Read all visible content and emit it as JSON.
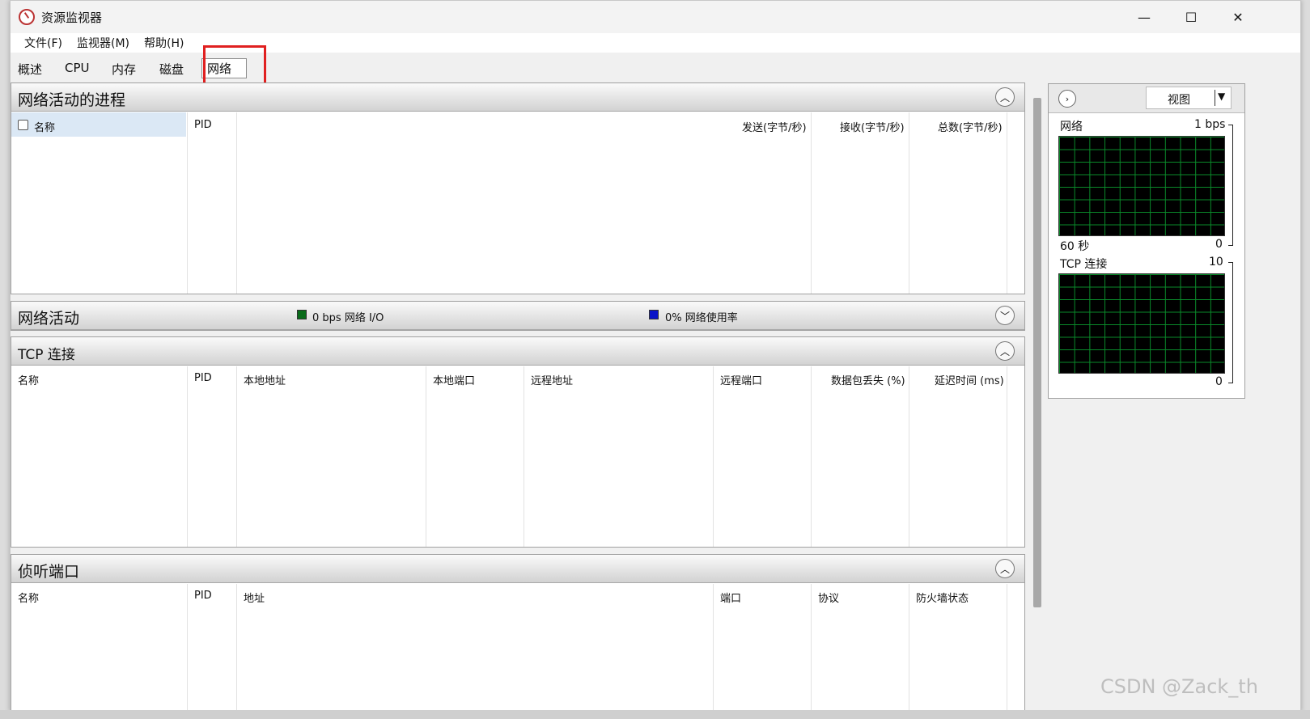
{
  "window": {
    "title": "资源监视器"
  },
  "window_controls": {
    "minimize": "—",
    "maximize": "☐",
    "close": "✕"
  },
  "menu": [
    "文件(F)",
    "监视器(M)",
    "帮助(H)"
  ],
  "tabs": [
    {
      "label": "概述",
      "active": false
    },
    {
      "label": "CPU",
      "active": false
    },
    {
      "label": "内存",
      "active": false
    },
    {
      "label": "磁盘",
      "active": false
    },
    {
      "label": "网络",
      "active": true
    }
  ],
  "processes_pane": {
    "title": "网络活动的进程",
    "columns": [
      "名称",
      "PID",
      "发送(字节/秒)",
      "接收(字节/秒)",
      "总数(字节/秒)"
    ]
  },
  "activity_pane": {
    "title": "网络活动",
    "legend_io": "0 bps 网络 I/O",
    "legend_util": "0% 网络使用率",
    "io_color": "#0a6b1a",
    "util_color": "#0a14c8"
  },
  "tcp_pane": {
    "title": "TCP 连接",
    "columns": [
      "名称",
      "PID",
      "本地地址",
      "本地端口",
      "远程地址",
      "远程端口",
      "数据包丢失 (%)",
      "延迟时间 (ms)"
    ]
  },
  "listen_pane": {
    "title": "侦听端口",
    "columns": [
      "名称",
      "PID",
      "地址",
      "端口",
      "协议",
      "防火墙状态"
    ]
  },
  "side_panel": {
    "view_label": "视图",
    "graph1": {
      "label": "网络",
      "max": "1 bps",
      "time": "60 秒",
      "min": "0"
    },
    "graph2": {
      "label": "TCP 连接",
      "max": "10",
      "min": "0"
    }
  },
  "watermark": "CSDN @Zack_th"
}
